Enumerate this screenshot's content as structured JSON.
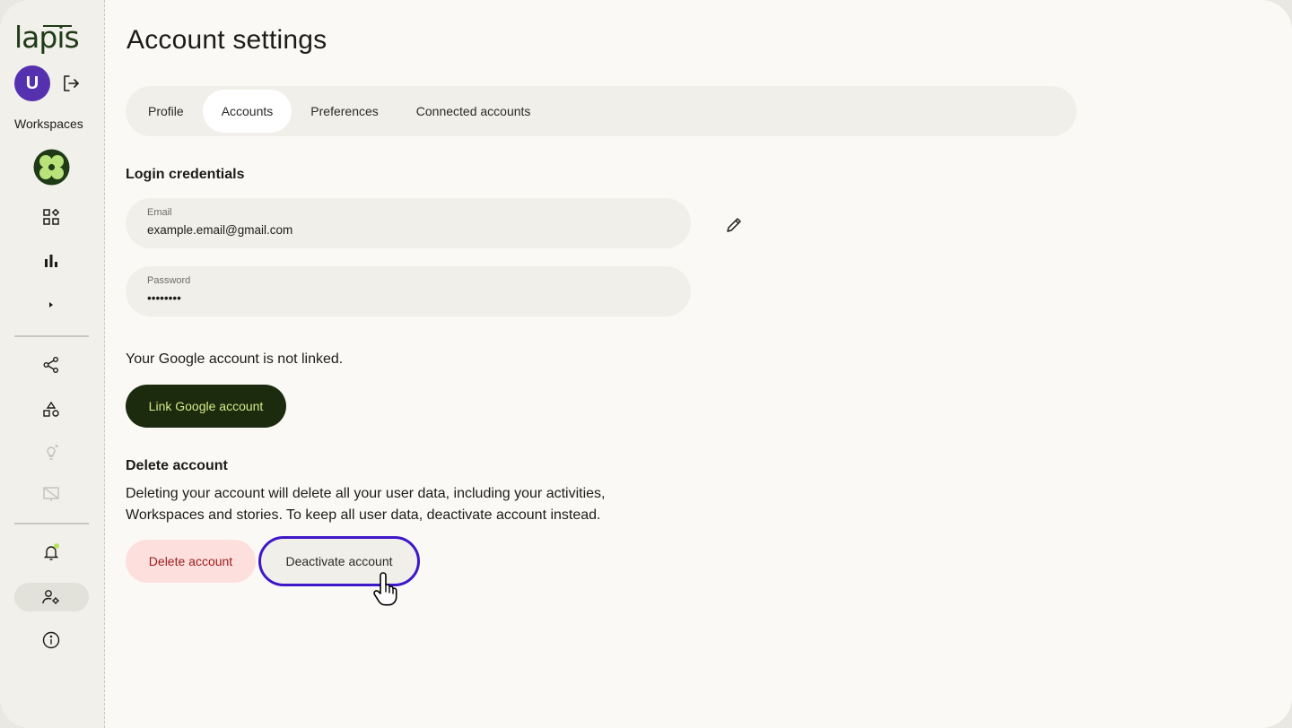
{
  "app": {
    "logo": "lapis"
  },
  "user": {
    "initial": "U"
  },
  "sidebar": {
    "workspaces_label": "Workspaces",
    "icons": [
      "dashboard-icon",
      "bar-chart-icon",
      "caret-right-icon",
      "share-icon",
      "shapes-icon",
      "lightbulb-icon",
      "presentation-icon",
      "bell-icon",
      "user-settings-icon",
      "info-icon"
    ],
    "notification_dot_color": "#b7e35a"
  },
  "page": {
    "title": "Account settings"
  },
  "tabs": [
    {
      "label": "Profile",
      "active": false
    },
    {
      "label": "Accounts",
      "active": true
    },
    {
      "label": "Preferences",
      "active": false
    },
    {
      "label": "Connected accounts",
      "active": false
    }
  ],
  "login": {
    "heading": "Login credentials",
    "email_label": "Email",
    "email_value": "example.email@gmail.com",
    "password_label": "Password",
    "password_value": "••••••••"
  },
  "google": {
    "status_text": "Your Google account is not linked.",
    "link_button": "Link Google account"
  },
  "delete": {
    "heading": "Delete account",
    "description_line1": "Deleting your account will delete all your user data, including your activities,",
    "description_line2": "Workspaces and stories. To keep all user data, deactivate account instead.",
    "delete_button": "Delete account",
    "deactivate_button": "Deactivate account"
  },
  "colors": {
    "accent": "#3e17c9",
    "avatar": "#5531b0",
    "brand_dark": "#1c2a0e",
    "brand_lime": "#d3ec86",
    "danger_bg": "#fde0de",
    "danger_text": "#9b1a1a"
  }
}
